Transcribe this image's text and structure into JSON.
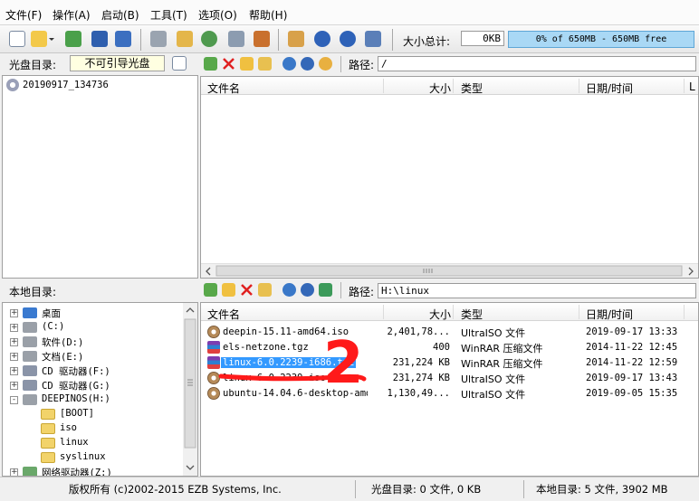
{
  "menu": [
    "文件(F)",
    "操作(A)",
    "启动(B)",
    "工具(T)",
    "选项(O)",
    "帮助(H)"
  ],
  "size_total_label": "大小总计:",
  "size_total_value": "0KB",
  "size_bar_text": "0% of 650MB - 650MB free",
  "size_bar_fraction": 0,
  "cd_dir_label": "光盘目录:",
  "cd_tag": "不可引导光盘",
  "path_label": "路径:",
  "cd_path": "/",
  "cd_tree_root": "20190917_134736",
  "columns": {
    "name": "文件名",
    "size": "大小",
    "type": "类型",
    "date": "日期/时间",
    "extra": "L"
  },
  "local_dir_label": "本地目录:",
  "local_path": "H:\\linux",
  "local_tree": [
    {
      "label": "桌面",
      "icon": "desktop-icon",
      "indent": 0,
      "expander": "+"
    },
    {
      "label": "(C:)",
      "icon": "drive-icon",
      "indent": 0,
      "expander": "+"
    },
    {
      "label": "软件(D:)",
      "icon": "drive-icon",
      "indent": 0,
      "expander": "+"
    },
    {
      "label": "文档(E:)",
      "icon": "drive-icon",
      "indent": 0,
      "expander": "+"
    },
    {
      "label": "CD 驱动器(F:)",
      "icon": "cd-drive-icon",
      "indent": 0,
      "expander": "+"
    },
    {
      "label": "CD 驱动器(G:)",
      "icon": "cd-drive-icon",
      "indent": 0,
      "expander": "+"
    },
    {
      "label": "DEEPINOS(H:)",
      "icon": "drive-icon",
      "indent": 0,
      "expander": "-"
    },
    {
      "label": "[BOOT]",
      "icon": "folder-icon",
      "indent": 1,
      "expander": ""
    },
    {
      "label": "iso",
      "icon": "folder-icon",
      "indent": 1,
      "expander": ""
    },
    {
      "label": "linux",
      "icon": "folder-icon",
      "indent": 1,
      "expander": ""
    },
    {
      "label": "syslinux",
      "icon": "folder-icon",
      "indent": 1,
      "expander": ""
    },
    {
      "label": "网络驱动器(Z:)",
      "icon": "network-drive-icon",
      "indent": 0,
      "expander": "+"
    }
  ],
  "local_files": [
    {
      "name": "deepin-15.11-amd64.iso",
      "size": "2,401,78...",
      "type": "UltraISO 文件",
      "date": "2019-09-17 13:33",
      "icon": "iso-file-icon",
      "selected": false
    },
    {
      "name": "els-netzone.tgz",
      "size": "400",
      "type": "WinRAR 压缩文件",
      "date": "2014-11-22 12:45",
      "icon": "winrar-file-icon",
      "selected": false
    },
    {
      "name": "linux-6.0.2239-i686.txz",
      "size": "231,224 KB",
      "type": "WinRAR 压缩文件",
      "date": "2014-11-22 12:59",
      "icon": "winrar-file-icon",
      "selected": true
    },
    {
      "name": "linux-6.0.2239.iso",
      "size": "231,274 KB",
      "type": "UltraISO 文件",
      "date": "2019-09-17 13:43",
      "icon": "iso-file-icon",
      "selected": false
    },
    {
      "name": "ubuntu-14.04.6-desktop-amd...",
      "size": "1,130,49...",
      "type": "UltraISO 文件",
      "date": "2019-09-05 15:35",
      "icon": "iso-file-icon",
      "selected": false
    }
  ],
  "annotation": "2",
  "status": {
    "copyright": "版权所有 (c)2002-2015 EZB Systems, Inc.",
    "cd_dir": "光盘目录: 0 文件, 0 KB",
    "local_dir": "本地目录: 5 文件, 3902 MB"
  },
  "colors": {
    "selection": "#3399ff",
    "annotation": "#ff1a1a",
    "size_bar": "#a9d8f5",
    "tag_bg": "#ffffe1"
  }
}
